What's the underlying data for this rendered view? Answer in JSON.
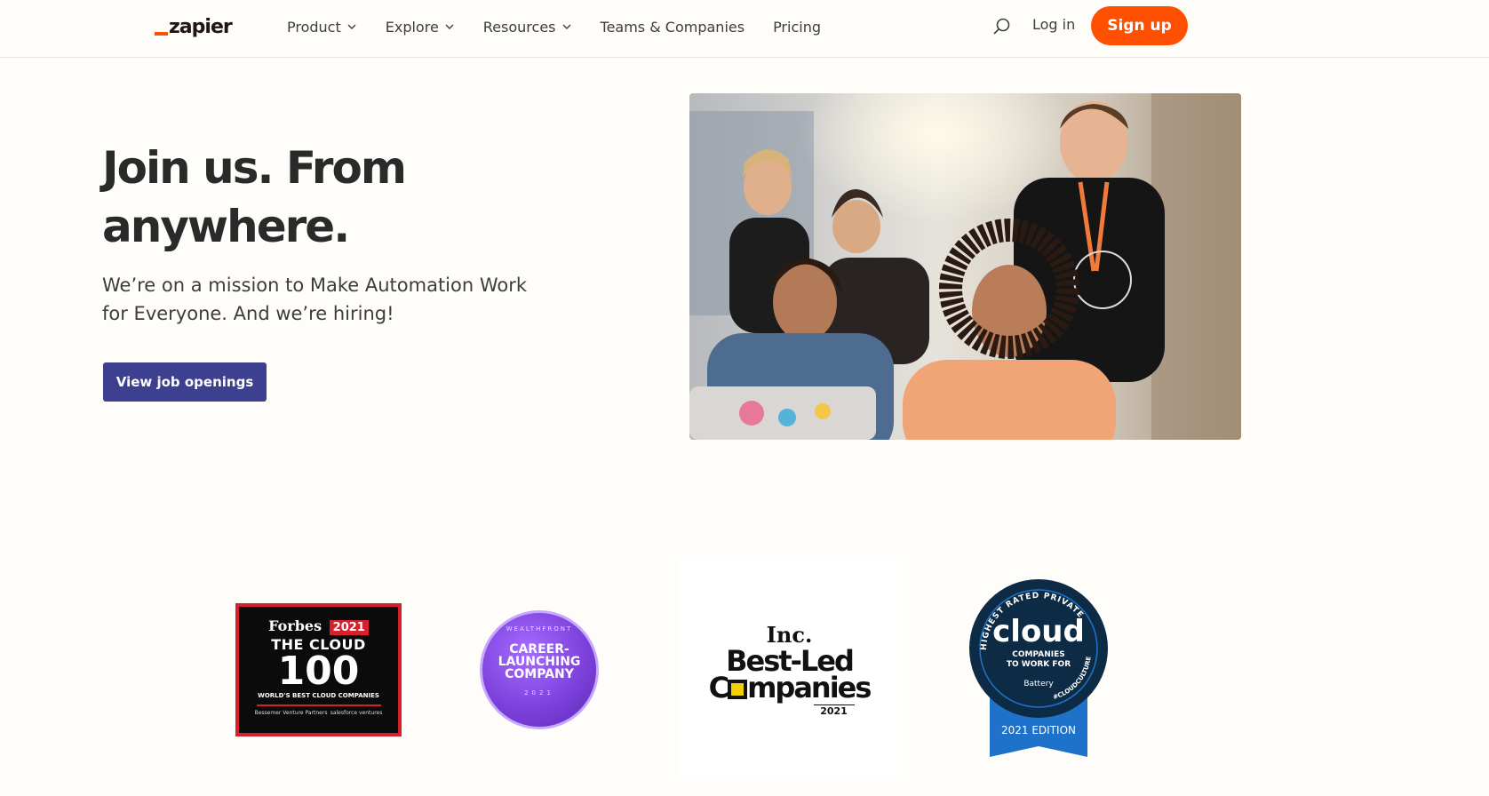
{
  "header": {
    "logo_text": "zapier",
    "nav": [
      {
        "label": "Product",
        "has_dropdown": true
      },
      {
        "label": "Explore",
        "has_dropdown": true
      },
      {
        "label": "Resources",
        "has_dropdown": true
      },
      {
        "label": "Teams & Companies",
        "has_dropdown": false
      },
      {
        "label": "Pricing",
        "has_dropdown": false
      }
    ],
    "search_icon": "search-icon",
    "login_label": "Log in",
    "signup_label": "Sign up"
  },
  "hero": {
    "title": "Join us. From anywhere.",
    "subtitle": "We’re on a mission to Make Automation Work for Everyone. And we’re hiring!",
    "cta_label": "View job openings"
  },
  "badges": {
    "forbes": {
      "brand": "Forbes",
      "year": "2021",
      "line1": "THE CLOUD",
      "line2": "100",
      "line3": "WORLD'S BEST CLOUD COMPANIES",
      "partner1": "Bessemer Venture Partners",
      "partner2": "salesforce ventures"
    },
    "wealthfront": {
      "brand": "WEALTHFRONT",
      "title": "CAREER-LAUNCHING COMPANY",
      "year": "2021"
    },
    "inc": {
      "brand": "Inc.",
      "line1": "Best-Led",
      "line2_pre": "C",
      "line2_post": "mpanies",
      "year": "2021"
    },
    "cloud_culture": {
      "arc_top": "HIGHEST RATED PRIVATE",
      "title": "cloud",
      "line1": "COMPANIES",
      "line2": "TO WORK FOR",
      "sponsor": "Battery",
      "hashtag": "#CLOUDCULTURE",
      "edition": "2021 EDITION"
    }
  },
  "colors": {
    "background": "#fffdf9",
    "accent_orange": "#ff4f00",
    "cta_indigo": "#3d3f8f"
  }
}
